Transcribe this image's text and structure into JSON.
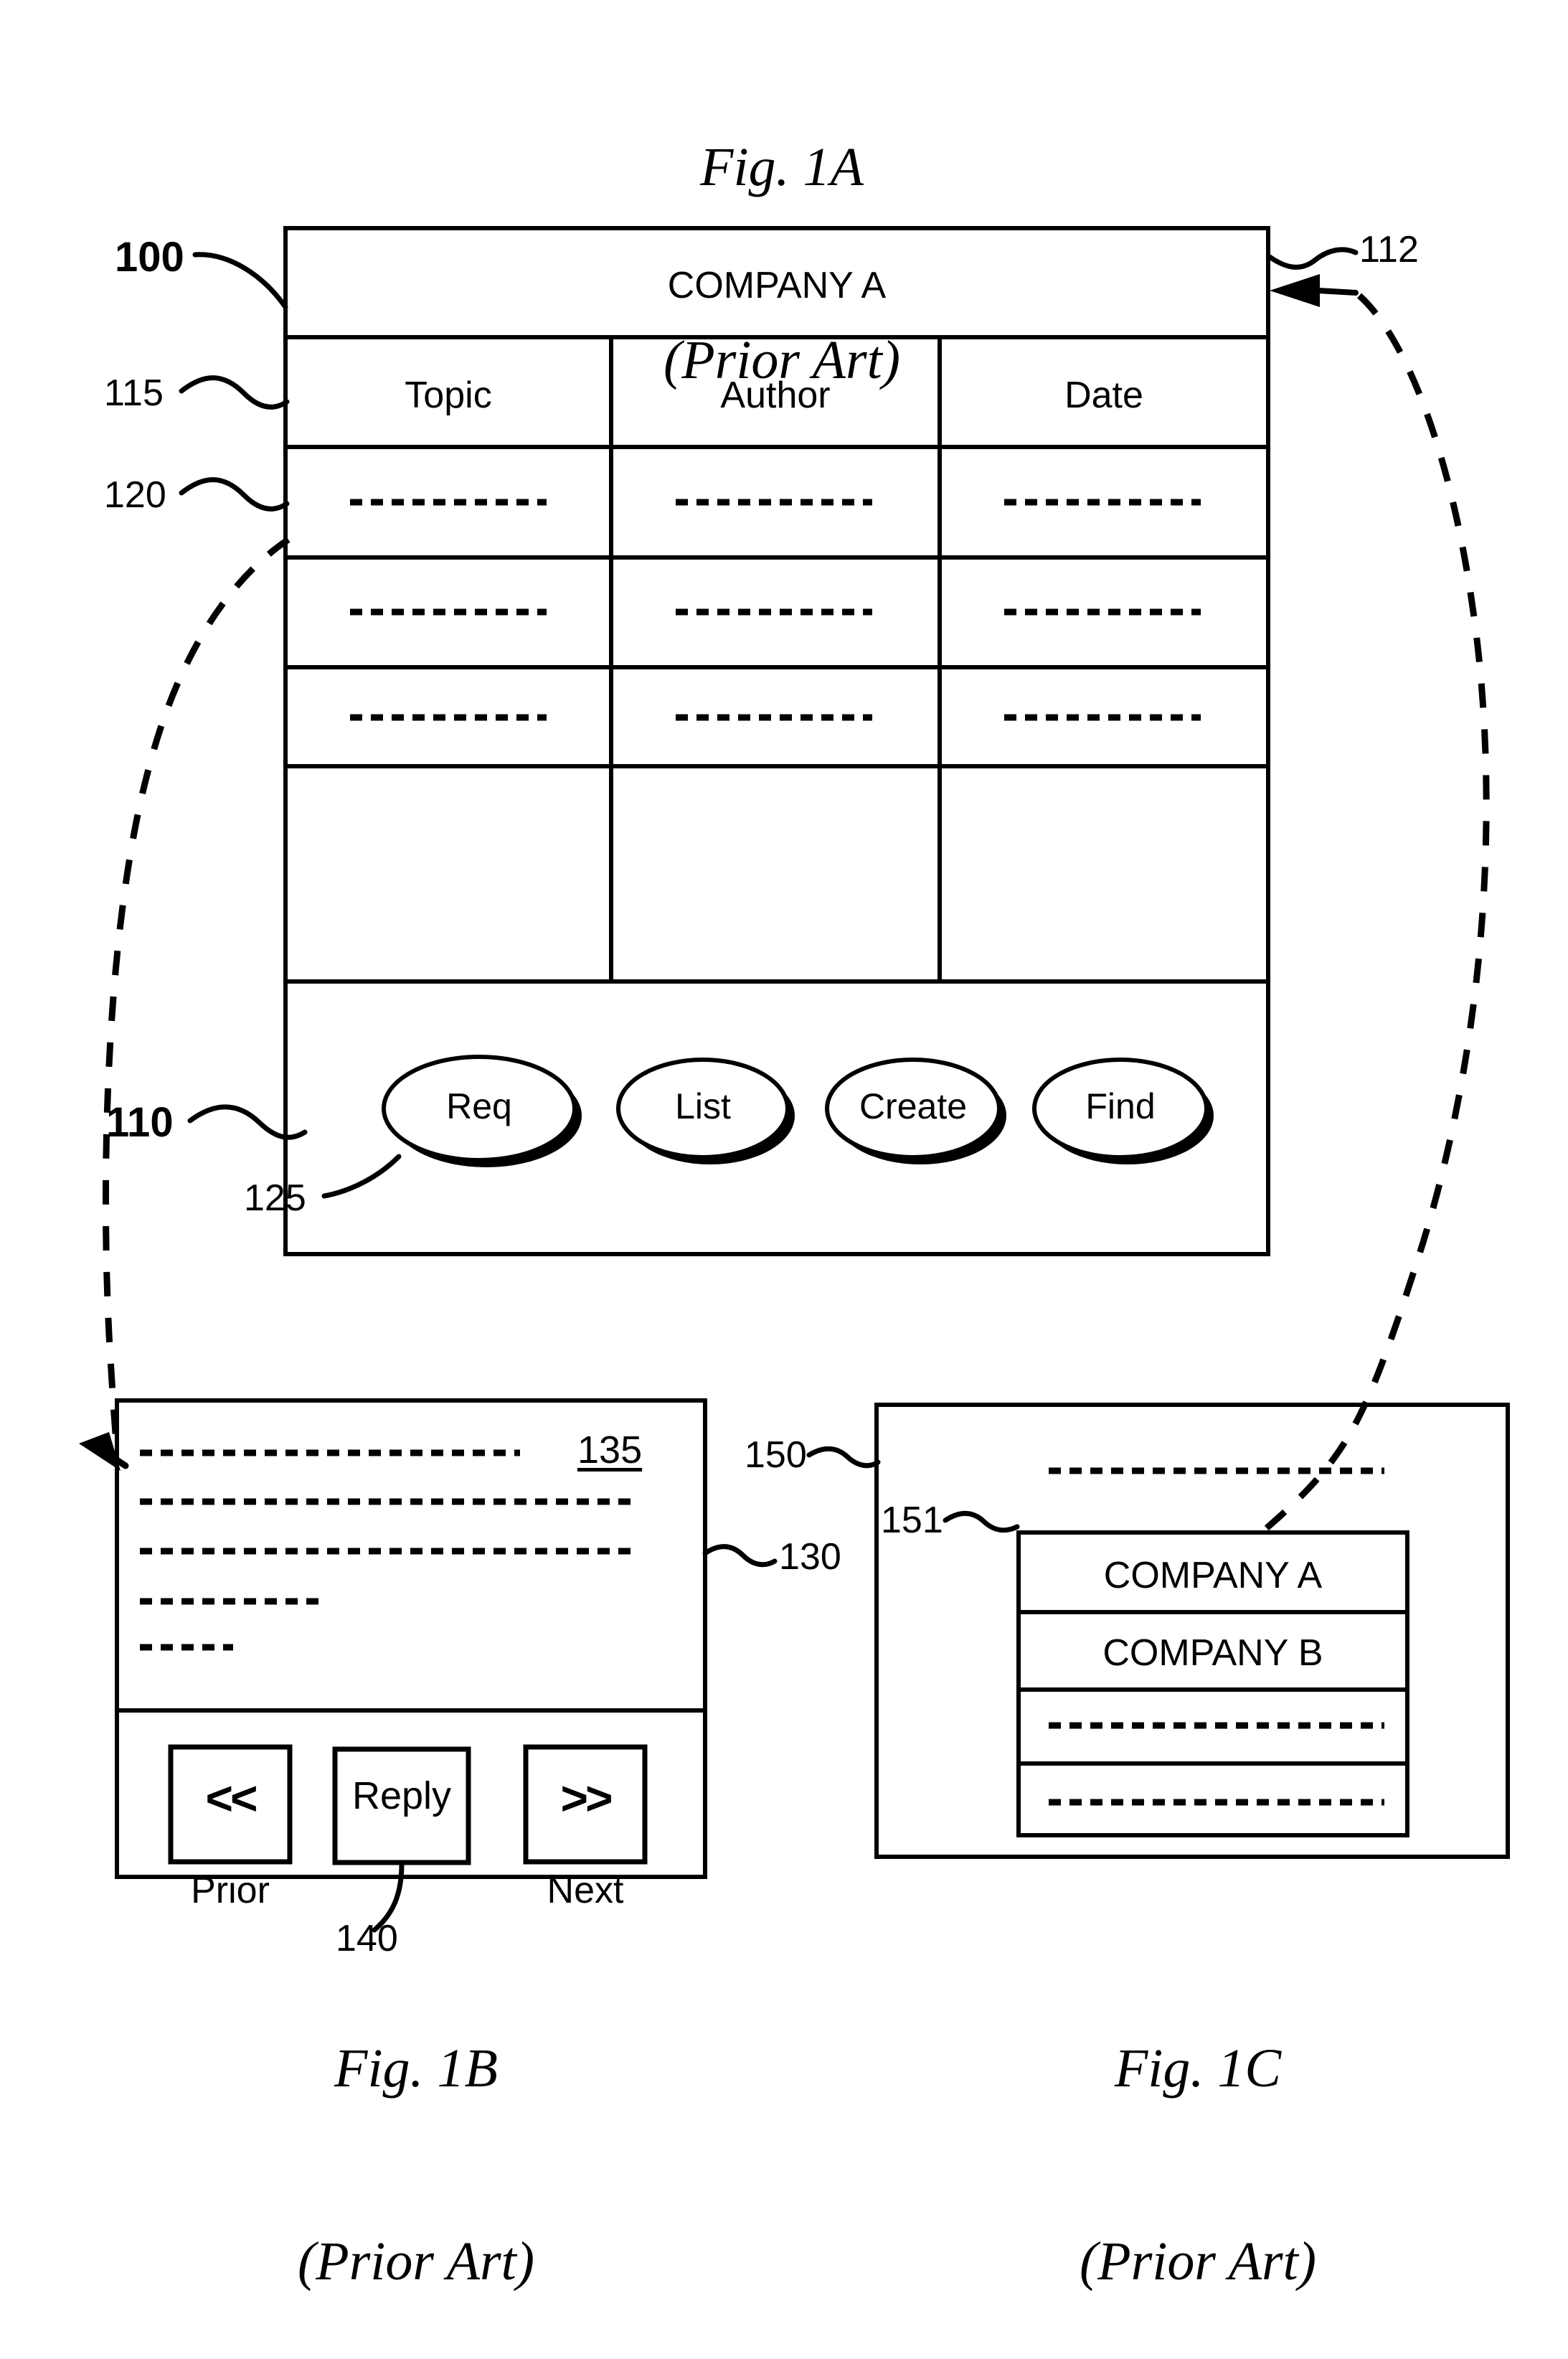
{
  "figures": {
    "a": {
      "caption_line1": "Fig. 1A",
      "caption_line2": "(Prior Art)",
      "window_title": "COMPANY A",
      "columns": [
        "Topic",
        "Author",
        "Date"
      ],
      "rows": [
        {
          "topic": "-------------",
          "author": "-------------",
          "date": "-------------"
        },
        {
          "topic": "-------------",
          "author": "-------------",
          "date": "-------------"
        },
        {
          "topic": "-------------",
          "author": "-------------",
          "date": "-------------"
        },
        {
          "topic": "",
          "author": "",
          "date": ""
        }
      ],
      "buttons": [
        "Req",
        "List",
        "Create",
        "Find"
      ],
      "refs": {
        "window": "100",
        "header_row": "115",
        "data_row": "120",
        "button_bar": "110",
        "button": "125",
        "title_bar": "112"
      }
    },
    "b": {
      "caption_line1": "Fig. 1B",
      "caption_line2": "(Prior Art)",
      "body_lines": [
        "---------------------------",
        "----------------------------",
        "----------------------------",
        "--------------",
        "-------"
      ],
      "message_number": "135",
      "buttons": [
        {
          "glyph": "<<",
          "label": "Prior"
        },
        {
          "glyph": "Reply",
          "label": ""
        },
        {
          "glyph": ">>",
          "label": "Next"
        }
      ],
      "refs": {
        "window": "130",
        "reply_button": "140"
      }
    },
    "c": {
      "caption_line1": "Fig. 1C",
      "caption_line2": "(Prior Art)",
      "top_line": "--------------------------",
      "list_items": [
        "COMPANY A",
        "COMPANY B",
        "--------------------------",
        "--------------------------"
      ],
      "refs": {
        "window": "150",
        "list_item": "151"
      }
    }
  },
  "colors": {
    "ink": "#000000",
    "paper": "#ffffff"
  }
}
